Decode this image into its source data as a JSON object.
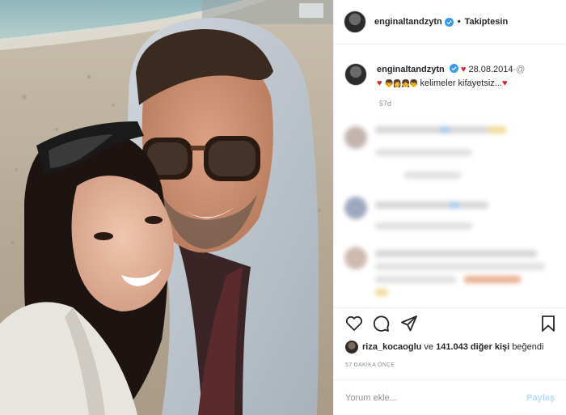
{
  "header": {
    "username": "enginaltandzytn",
    "separator": "•",
    "follow_status": "Takiptesin"
  },
  "caption": {
    "username": "enginaltandzytn",
    "date": "28.08.2014",
    "text": "kelimeler kifayetsiz...",
    "age": "57d"
  },
  "likes": {
    "liker": "riza_kocaoglu",
    "connector": "ve",
    "count_text": "141.043 diğer kişi",
    "suffix": "beğendi"
  },
  "time_ago": "57 DAKİKA ÖNCE",
  "comment_box": {
    "placeholder": "Yorum ekle...",
    "share_label": "Paylaş"
  },
  "colors": {
    "verified": "#3897f0",
    "heart": "#d21f3c",
    "muted": "#8e8e8e",
    "share_disabled": "#b3dbff",
    "border": "#efefef"
  },
  "icons": [
    "verified-badge-icon",
    "heart-icon",
    "comment-icon",
    "share-icon",
    "bookmark-icon"
  ]
}
